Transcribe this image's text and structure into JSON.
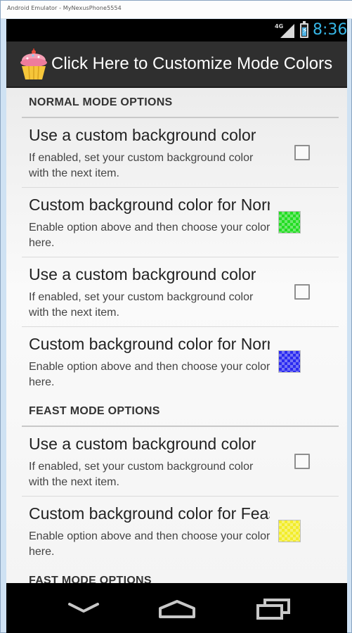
{
  "window": {
    "title": "Android Emulator - MyNexusPhone5554"
  },
  "status_bar": {
    "network": "4G",
    "time": "8:36"
  },
  "action_bar": {
    "title": "Click Here to Customize Mode Colors",
    "icon": "cupcake-icon"
  },
  "sections": [
    {
      "header": "NORMAL MODE OPTIONS",
      "items": [
        {
          "kind": "checkbox",
          "title": "Use a custom background color",
          "summary": "If enabled, set your custom background color with the next item.",
          "checked": false
        },
        {
          "kind": "color",
          "title": "Custom background color for Normal",
          "summary": "Enable option above and then choose your color here.",
          "color": "#22dd22"
        },
        {
          "kind": "checkbox",
          "title": "Use a custom background color",
          "summary": "If enabled, set your custom background color with the next item.",
          "checked": false
        },
        {
          "kind": "color",
          "title": "Custom background color for Normal",
          "summary": "Enable option above and then choose your color here.",
          "color": "#2a2af0"
        }
      ]
    },
    {
      "header": "FEAST MODE OPTIONS",
      "items": [
        {
          "kind": "checkbox",
          "title": "Use a custom background color",
          "summary": "If enabled, set your custom background color with the next item.",
          "checked": false
        },
        {
          "kind": "color",
          "title": "Custom background color for Feast",
          "summary": "Enable option above and then choose your color here.",
          "color": "#f2ec2a"
        }
      ]
    },
    {
      "header": "FAST MODE OPTIONS",
      "items": []
    }
  ],
  "nav_bar": {
    "back": "back-icon",
    "home": "home-icon",
    "recents": "recents-icon"
  },
  "colors": {
    "accent": "#36b5e5",
    "action_bar": "#2f2f2f"
  }
}
